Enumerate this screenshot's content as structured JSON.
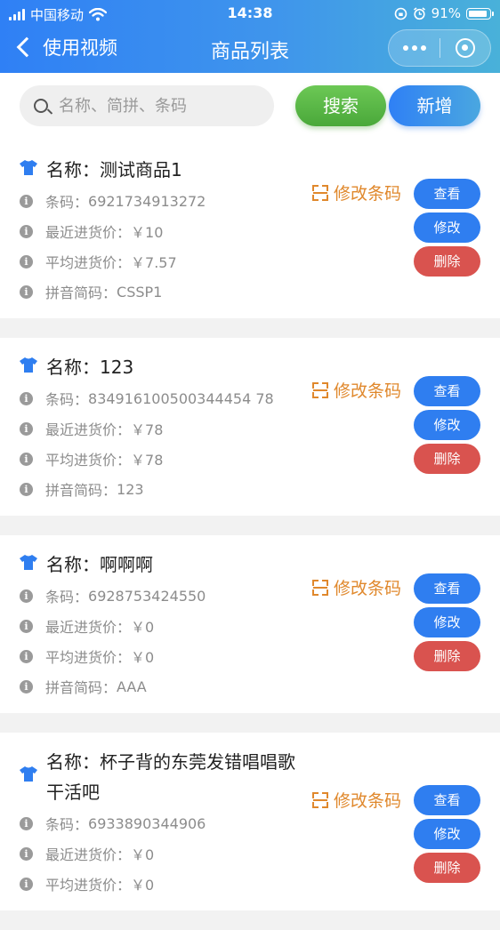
{
  "status_bar": {
    "carrier": "中国移动",
    "time": "14:38",
    "battery": "91%"
  },
  "nav": {
    "back_label": "使用视频",
    "title": "商品列表"
  },
  "search": {
    "placeholder": "名称、简拼、条码",
    "value": "",
    "search_label": "搜索",
    "add_label": "新增"
  },
  "labels": {
    "barcode_prefix": "条码：",
    "recent_price_prefix": "最近进货价：",
    "avg_price_prefix": "平均进货价：",
    "pinyin_prefix": "拼音简码：",
    "edit_barcode": "修改条码",
    "view": "查看",
    "edit": "修改",
    "delete": "删除"
  },
  "products": [
    {
      "name": "名称：测试商品1",
      "barcode": "6921734913272",
      "recent_price": "￥10",
      "avg_price": "￥7.57",
      "pinyin": "CSSP1"
    },
    {
      "name": "名称：123",
      "barcode": "834916100500344454 78",
      "recent_price": "￥78",
      "avg_price": "￥78",
      "pinyin": "123"
    },
    {
      "name": "名称：啊啊啊",
      "barcode": "6928753424550",
      "recent_price": "￥0",
      "avg_price": "￥0",
      "pinyin": "AAA"
    },
    {
      "name": "名称：杯子背的东莞发错唱唱歌干活吧",
      "barcode": "6933890344906",
      "recent_price": "￥0",
      "avg_price": "￥0",
      "pinyin": ""
    }
  ],
  "colors": {
    "nav_gradient_start": "#2f80f5",
    "nav_gradient_end": "#49b1d9",
    "search_green": "#5bb847",
    "action_blue": "#2f7ef0",
    "delete_red": "#d9534f",
    "link_orange": "#e0882c"
  },
  "icons": {
    "back": "chevron-left-icon",
    "more": "more-dots-icon",
    "close": "capsule-close-icon",
    "search": "search-icon",
    "product": "shirt-icon",
    "info": "info-icon",
    "scan": "scan-barcode-icon"
  }
}
